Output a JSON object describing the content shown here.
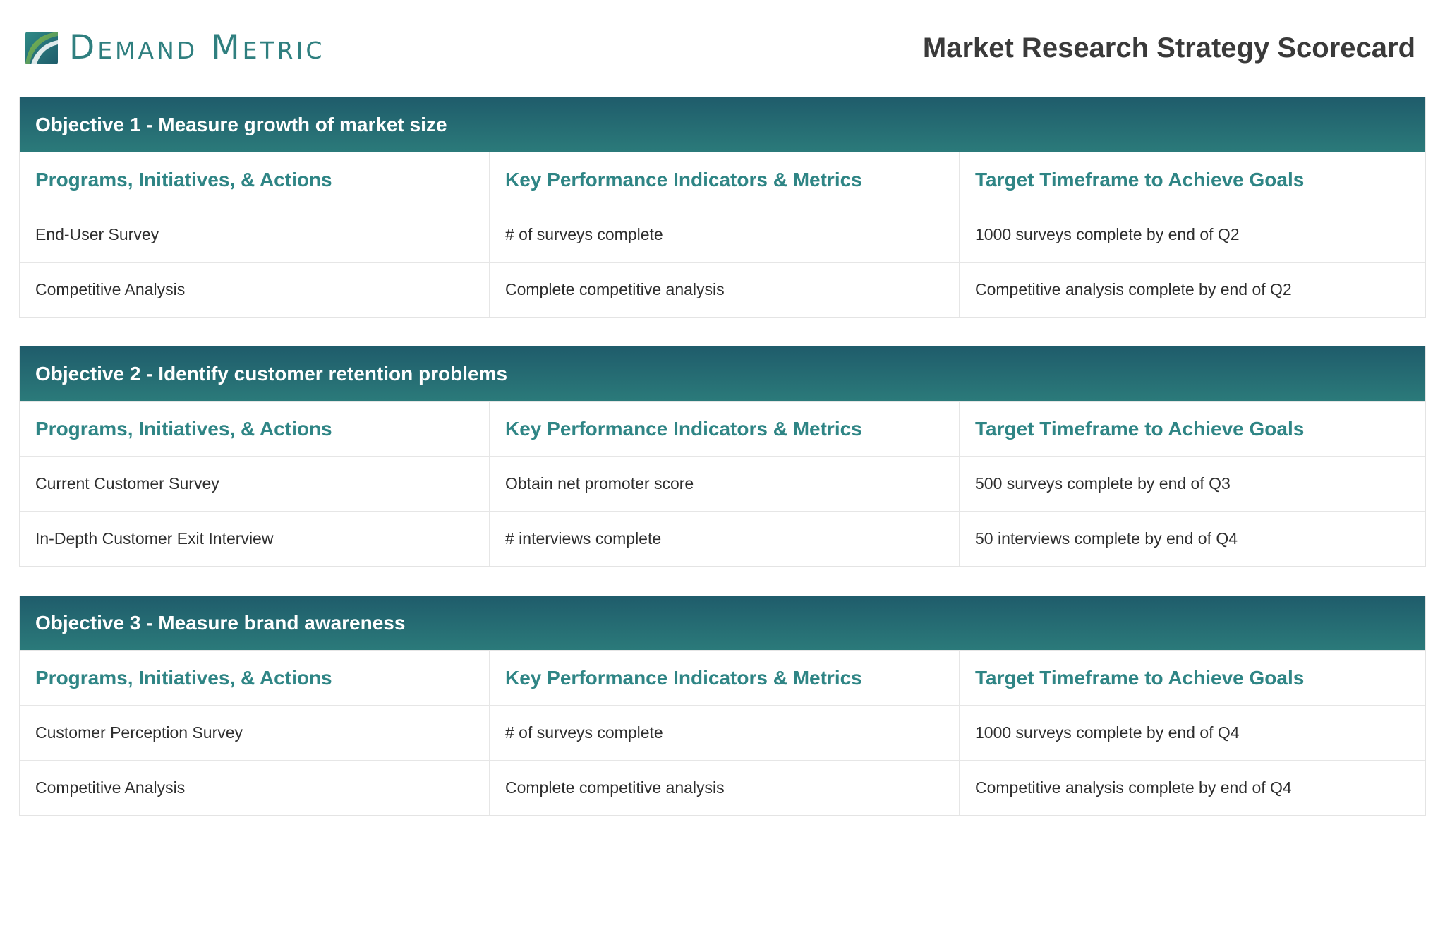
{
  "brand": {
    "logo_text": "Demand Metric",
    "logo_icon": "leaf-logo-icon",
    "accent_color": "#2f7f7f"
  },
  "document": {
    "title": "Market Research Strategy Scorecard"
  },
  "table_headers": {
    "programs": "Programs, Initiatives, & Actions",
    "kpis": "Key Performance Indicators & Metrics",
    "timeframe": "Target Timeframe to Achieve Goals"
  },
  "objectives": [
    {
      "title": "Objective 1 - Measure growth of market size",
      "rows": [
        {
          "program": "End-User Survey",
          "kpi": "# of surveys complete",
          "target": "1000 surveys complete by end of Q2"
        },
        {
          "program": "Competitive Analysis",
          "kpi": "Complete competitive analysis",
          "target": "Competitive analysis complete by end of Q2"
        }
      ]
    },
    {
      "title": "Objective 2 - Identify customer retention problems",
      "rows": [
        {
          "program": "Current Customer Survey",
          "kpi": "Obtain net promoter score",
          "target": "500 surveys complete by end of Q3"
        },
        {
          "program": "In-Depth Customer Exit Interview",
          "kpi": "# interviews complete",
          "target": "50 interviews complete by end of Q4"
        }
      ]
    },
    {
      "title": "Objective 3 - Measure brand awareness",
      "rows": [
        {
          "program": "Customer Perception Survey",
          "kpi": "# of surveys complete",
          "target": "1000 surveys complete by end of Q4"
        },
        {
          "program": "Competitive Analysis",
          "kpi": "Complete competitive analysis",
          "target": "Competitive analysis complete by end of Q4"
        }
      ]
    }
  ]
}
